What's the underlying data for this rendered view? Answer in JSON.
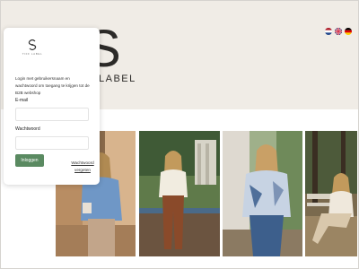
{
  "brand": {
    "letter": "S",
    "subtitle": "LABEL",
    "logo_word": "TIFF LABEL"
  },
  "languages": [
    {
      "name": "nl-flag-icon"
    },
    {
      "name": "uk-flag-icon"
    },
    {
      "name": "de-flag-icon"
    }
  ],
  "login": {
    "intro": "Login met gebruikersnaam en wachtwoord om toegang te krijgen tot de B2B webshop",
    "email_label": "E-mail",
    "email_value": "",
    "password_label": "Wachtwoord",
    "password_value": "",
    "button_label": "Inloggen",
    "forgot_label": "Wachtwoord vergeten"
  },
  "colors": {
    "hero_background": "#f0ece6",
    "button": "#5a8a61"
  }
}
